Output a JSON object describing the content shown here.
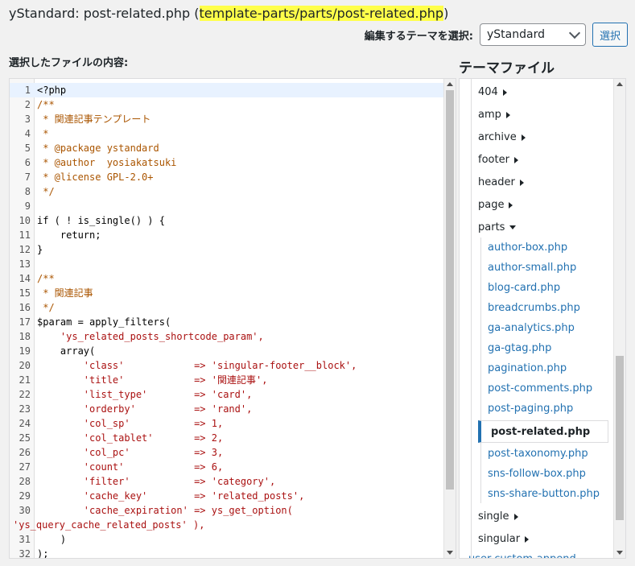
{
  "header": {
    "title_prefix": "yStandard: post-related.php (",
    "title_path": "template-parts/parts/post-related.php",
    "title_suffix": ")",
    "theme_select_label": "編集するテーマを選択:",
    "theme_selected": "yStandard",
    "select_button": "選択"
  },
  "editor": {
    "label": "選択したファイルの内容:"
  },
  "code_lines": [
    {
      "n": "1",
      "t": "<?php",
      "c": "plain"
    },
    {
      "n": "2",
      "t": "/**",
      "c": "cmt"
    },
    {
      "n": "3",
      "t": " * 関連記事テンプレート",
      "c": "cmt"
    },
    {
      "n": "4",
      "t": " *",
      "c": "cmt"
    },
    {
      "n": "5",
      "t": " * @package ystandard",
      "c": "cmt"
    },
    {
      "n": "6",
      "t": " * @author  yosiakatsuki",
      "c": "cmt"
    },
    {
      "n": "7",
      "t": " * @license GPL-2.0+",
      "c": "cmt"
    },
    {
      "n": "8",
      "t": " */",
      "c": "cmt"
    },
    {
      "n": "9",
      "t": "",
      "c": "plain"
    },
    {
      "n": "10",
      "t": "if ( ! is_single() ) {",
      "c": "plain"
    },
    {
      "n": "11",
      "t": "    return;",
      "c": "plain"
    },
    {
      "n": "12",
      "t": "}",
      "c": "plain"
    },
    {
      "n": "13",
      "t": "",
      "c": "plain"
    },
    {
      "n": "14",
      "t": "/**",
      "c": "cmt"
    },
    {
      "n": "15",
      "t": " * 関連記事",
      "c": "cmt"
    },
    {
      "n": "16",
      "t": " */",
      "c": "cmt"
    },
    {
      "n": "17",
      "t": "$param = apply_filters(",
      "c": "plain"
    },
    {
      "n": "18",
      "t": "    'ys_related_posts_shortcode_param',",
      "c": "str"
    },
    {
      "n": "19",
      "t": "    array(",
      "c": "plain"
    },
    {
      "n": "20",
      "t": "        'class'            => 'singular-footer__block',",
      "c": "str"
    },
    {
      "n": "21",
      "t": "        'title'            => '関連記事',",
      "c": "str"
    },
    {
      "n": "22",
      "t": "        'list_type'        => 'card',",
      "c": "str"
    },
    {
      "n": "23",
      "t": "        'orderby'          => 'rand',",
      "c": "str"
    },
    {
      "n": "24",
      "t": "        'col_sp'           => 1,",
      "c": "str"
    },
    {
      "n": "25",
      "t": "        'col_tablet'       => 2,",
      "c": "str"
    },
    {
      "n": "26",
      "t": "        'col_pc'           => 3,",
      "c": "str"
    },
    {
      "n": "27",
      "t": "        'count'            => 6,",
      "c": "str"
    },
    {
      "n": "28",
      "t": "        'filter'           => 'category',",
      "c": "str"
    },
    {
      "n": "29",
      "t": "        'cache_key'        => 'related_posts',",
      "c": "str"
    },
    {
      "n": "30",
      "t": "        'cache_expiration' => ys_get_option(",
      "c": "str"
    },
    {
      "n": "",
      "t": "'ys_query_cache_related_posts' ),",
      "c": "str"
    },
    {
      "n": "31",
      "t": "    )",
      "c": "plain"
    },
    {
      "n": "32",
      "t": ");",
      "c": "plain"
    }
  ],
  "sidebar": {
    "title": "テーマファイル",
    "folders_top": [
      "404",
      "amp",
      "archive",
      "footer",
      "header",
      "page"
    ],
    "open_folder": "parts",
    "files": [
      "author-box.php",
      "author-small.php",
      "blog-card.php",
      "breadcrumbs.php",
      "ga-analytics.php",
      "ga-gtag.php",
      "pagination.php",
      "post-comments.php",
      "post-paging.php",
      "post-related.php",
      "post-taxonomy.php",
      "sns-follow-box.php",
      "sns-share-button.php"
    ],
    "selected_file": "post-related.php",
    "folders_bottom": [
      "single",
      "singular"
    ],
    "clipped_item": "user-custom-append"
  }
}
